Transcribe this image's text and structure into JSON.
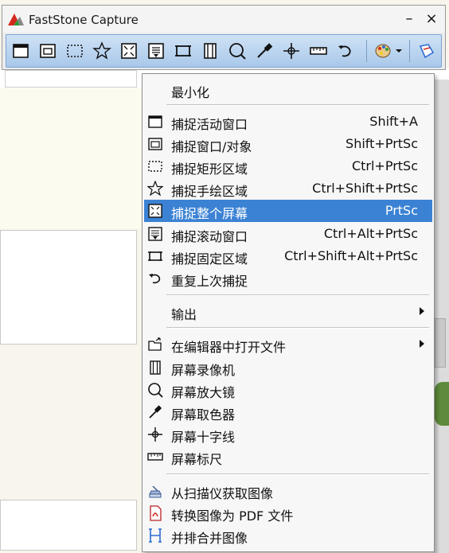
{
  "window": {
    "title": "FastStone Capture",
    "min_glyph": "–",
    "close_glyph": "×"
  },
  "toolbar": {
    "buttons": [
      "window-icon",
      "window-object-icon",
      "rectangle-region-icon",
      "freehand-region-icon",
      "full-screen-icon",
      "scrolling-window-icon",
      "fixed-region-icon",
      "screen-recorder-icon",
      "magnifier-icon",
      "color-picker-icon",
      "crosshair-icon",
      "ruler-icon",
      "repeat-capture-icon",
      "palette-icon",
      "settings-icon"
    ]
  },
  "menu": {
    "minimize": "最小化",
    "capture_active_window": {
      "label": "捕捉活动窗口",
      "shortcut": "Shift+A"
    },
    "capture_window_object": {
      "label": "捕捉窗口/对象",
      "shortcut": "Shift+PrtSc"
    },
    "capture_rect_region": {
      "label": "捕捉矩形区域",
      "shortcut": "Ctrl+PrtSc"
    },
    "capture_freehand_region": {
      "label": "捕捉手绘区域",
      "shortcut": "Ctrl+Shift+PrtSc"
    },
    "capture_full_screen": {
      "label": "捕捉整个屏幕",
      "shortcut": "PrtSc"
    },
    "capture_scrolling_window": {
      "label": "捕捉滚动窗口",
      "shortcut": "Ctrl+Alt+PrtSc"
    },
    "capture_fixed_region": {
      "label": "捕捉固定区域",
      "shortcut": "Ctrl+Shift+Alt+PrtSc"
    },
    "repeat_last_capture": {
      "label": "重复上次捕捉"
    },
    "output": {
      "label": "输出"
    },
    "open_in_editor": {
      "label": "在编辑器中打开文件"
    },
    "screen_recorder": {
      "label": "屏幕录像机"
    },
    "screen_magnifier": {
      "label": "屏幕放大镜"
    },
    "screen_color_picker": {
      "label": "屏幕取色器"
    },
    "screen_crosshair": {
      "label": "屏幕十字线"
    },
    "screen_ruler": {
      "label": "屏幕标尺"
    },
    "acquire_from_scanner": {
      "label": "从扫描仪获取图像"
    },
    "convert_to_pdf": {
      "label": "转换图像为 PDF 文件"
    },
    "combine_images": {
      "label": "并排合并图像"
    }
  },
  "colors": {
    "highlight": "#3b82d4",
    "toolbar": "#b8d3ef",
    "menu_bg": "#f7f7f7"
  }
}
